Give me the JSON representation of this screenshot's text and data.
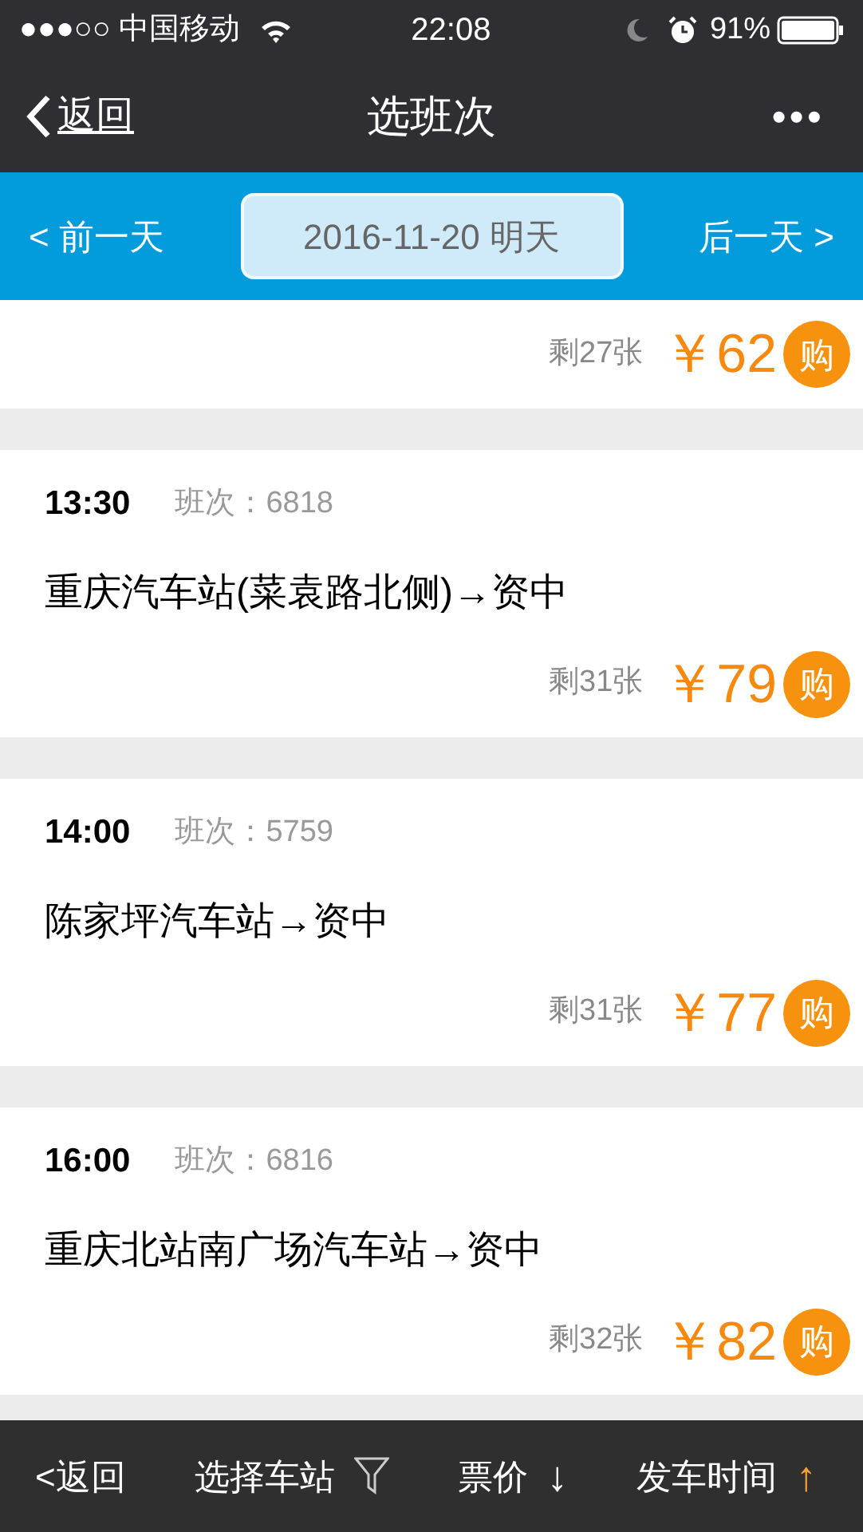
{
  "status_bar": {
    "carrier": "●●●○○ 中国移动",
    "time": "22:08",
    "battery": "91%"
  },
  "nav": {
    "back": "返回",
    "title": "选班次",
    "more": "•••"
  },
  "date_bar": {
    "prev": "< 前一天",
    "date": "2016-11-20 明天",
    "next": "后一天 >"
  },
  "trips": [
    {
      "kind": "partial",
      "remaining": "剩27张",
      "price": "￥62",
      "buy": "购"
    },
    {
      "kind": "full",
      "time": "13:30",
      "number": "班次：6818",
      "route": "重庆汽车站(菜袁路北侧)→资中",
      "remaining": "剩31张",
      "price": "￥79",
      "buy": "购"
    },
    {
      "kind": "full",
      "time": "14:00",
      "number": "班次：5759",
      "route": "陈家坪汽车站→资中",
      "remaining": "剩31张",
      "price": "￥77",
      "buy": "购"
    },
    {
      "kind": "full",
      "time": "16:00",
      "number": "班次：6816",
      "route": "重庆北站南广场汽车站→资中",
      "remaining": "剩32张",
      "price": "￥82",
      "buy": "购"
    }
  ],
  "bottom_bar": {
    "back": "<返回",
    "sorts": [
      {
        "kind": "filter",
        "label": "选择车站",
        "active": false
      },
      {
        "kind": "sort",
        "label": "票价",
        "arrow": "↓",
        "active": false
      },
      {
        "kind": "sort",
        "label": "发车时间",
        "arrow": "↑",
        "active": true
      }
    ]
  }
}
